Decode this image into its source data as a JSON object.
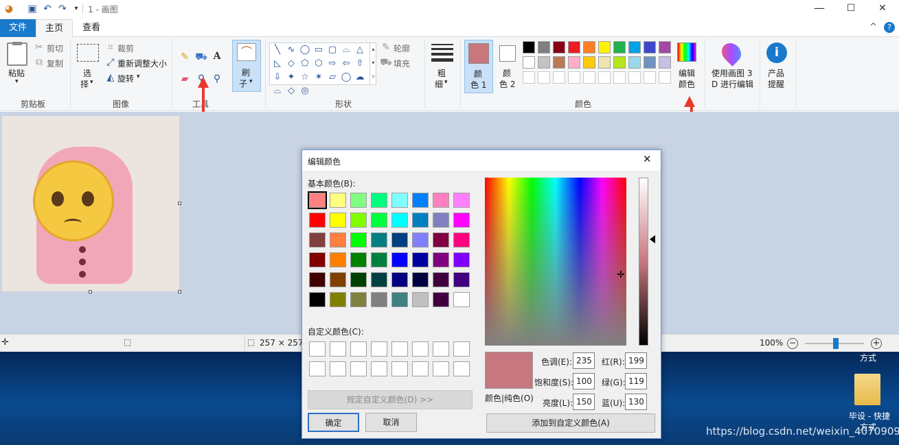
{
  "window": {
    "title": "1 - 画图",
    "min_icon": "—",
    "max_icon": "☐",
    "close_icon": "✕"
  },
  "tabs": {
    "file": "文件",
    "home": "主页",
    "view": "查看",
    "collapse": "^",
    "help": "?"
  },
  "ribbon": {
    "clipboard": {
      "paste": "粘贴",
      "paste_arrow": "▾",
      "cut": "剪切",
      "copy": "复制",
      "group": "剪贴板"
    },
    "image": {
      "select_1": "选",
      "select_2": "择",
      "select_arrow": "▾",
      "crop": "裁剪",
      "resize": "重新调整大小",
      "rotate": "旋转",
      "rotate_arrow": "▾",
      "group": "图像"
    },
    "tools": {
      "group": "工具"
    },
    "brush": {
      "label_1": "刷",
      "label_2": "子",
      "arrow": "▾"
    },
    "shapes": {
      "outline": "轮廓",
      "fill": "填充",
      "group": "形状",
      "shape_glyphs": [
        "╲",
        "∿",
        "◯",
        "▭",
        "▢",
        "⌓",
        "△",
        "◺",
        "◇",
        "⬠",
        "⬡",
        "⇨",
        "⇦",
        "⇧",
        "⇩",
        "✦",
        "☆",
        "✶",
        "▱",
        "◯",
        "☁",
        "⌓",
        "◇",
        "◎"
      ]
    },
    "size": {
      "label_1": "粗",
      "label_2": "细",
      "arrow": "▾"
    },
    "colors": {
      "color1_1": "颜",
      "color1_2": "色 1",
      "color2_1": "颜",
      "color2_2": "色 2",
      "color1_value": "#c8787d",
      "color2_value": "#ffffff",
      "palette_row1": [
        "#000000",
        "#7f7f7f",
        "#880015",
        "#ed1c24",
        "#ff7f27",
        "#fff200",
        "#22b14c",
        "#00a2e8",
        "#3f48cc",
        "#a349a4"
      ],
      "palette_row2": [
        "#ffffff",
        "#c3c3c3",
        "#b97a57",
        "#ffaec9",
        "#ffc90e",
        "#efe4b0",
        "#b5e61d",
        "#99d9ea",
        "#7092be",
        "#c8bfe7"
      ],
      "edit_1": "编辑",
      "edit_2": "颜色",
      "group": "颜色"
    },
    "paint3d": {
      "label_1": "使用画图 3",
      "label_2": "D 进行编辑"
    },
    "product": {
      "label_1": "产品",
      "label_2": "提醒"
    }
  },
  "status": {
    "size": "257 × 257",
    "zoom": "100%",
    "zoom_minus": "−",
    "zoom_plus": "+",
    "zoom_level": 0.52
  },
  "desktop": {
    "icon_label_top": "方式",
    "icon_label_1": "毕设 - 快捷",
    "icon_label_2": "方式",
    "watermark": "https://blog.csdn.net/weixin_40709094"
  },
  "dialog": {
    "title": "编辑颜色",
    "close": "✕",
    "basic_label": "基本颜色(B):",
    "basic_colors": [
      "#ff8080",
      "#ffff80",
      "#80ff80",
      "#00ff80",
      "#80ffff",
      "#0080ff",
      "#ff80c0",
      "#ff80ff",
      "#ff0000",
      "#ffff00",
      "#80ff00",
      "#00ff40",
      "#00ffff",
      "#0080c0",
      "#8080c0",
      "#ff00ff",
      "#804040",
      "#ff8040",
      "#00ff00",
      "#008080",
      "#004080",
      "#8080ff",
      "#800040",
      "#ff0080",
      "#800000",
      "#ff8000",
      "#008000",
      "#008040",
      "#0000ff",
      "#0000a0",
      "#800080",
      "#8000ff",
      "#400000",
      "#804000",
      "#004000",
      "#004040",
      "#000080",
      "#000040",
      "#400040",
      "#400080",
      "#000000",
      "#808000",
      "#808040",
      "#808080",
      "#408080",
      "#c0c0c0",
      "#400040",
      "#ffffff"
    ],
    "custom_label": "自定义颜色(C):",
    "define_button": "规定自定义颜色(D) >>",
    "ok": "确定",
    "cancel": "取消",
    "preview_label": "颜色|纯色(O)",
    "preview_color": "#c7777f",
    "hue_label": "色调(E):",
    "hue": "235",
    "sat_label": "饱和度(S):",
    "sat": "100",
    "lum_label": "亮度(L):",
    "lum": "150",
    "red_label": "红(R):",
    "red": "199",
    "green_label": "绿(G):",
    "green": "119",
    "blue_label": "蓝(U):",
    "blue": "130",
    "add_button": "添加到自定义颜色(A)"
  }
}
